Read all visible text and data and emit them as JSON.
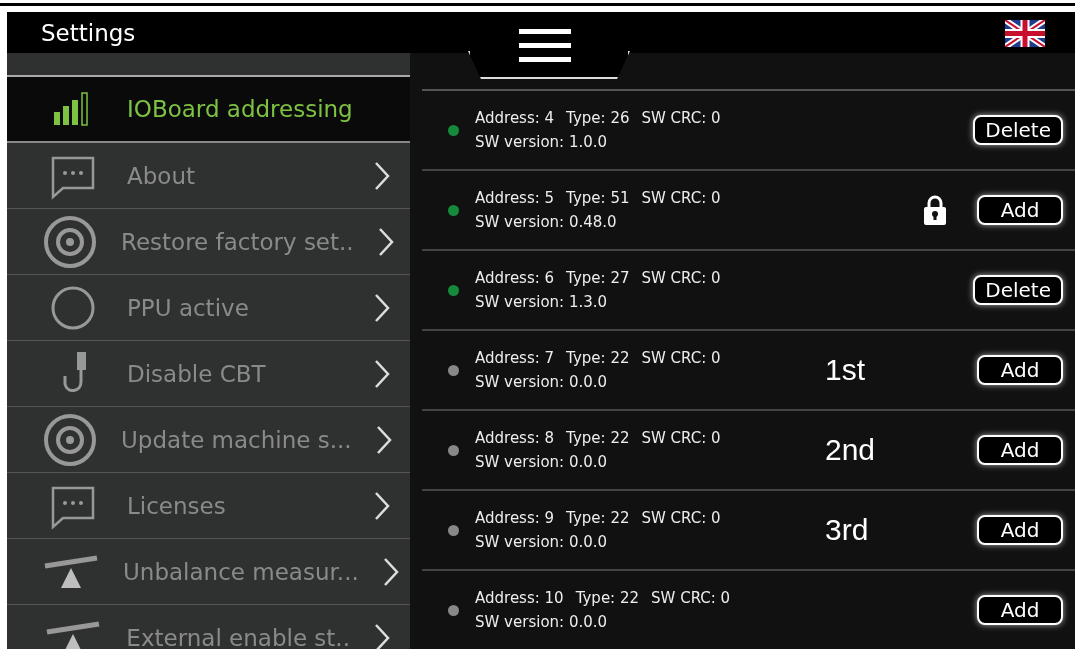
{
  "header": {
    "title": "Settings"
  },
  "sidebar": {
    "items": [
      {
        "label": "IOBoard addressing",
        "kind": "signal",
        "selected": true
      },
      {
        "label": "About",
        "kind": "bubble",
        "selected": false
      },
      {
        "label": "Restore factory set..",
        "kind": "target",
        "selected": false
      },
      {
        "label": "PPU active",
        "kind": "circle",
        "selected": false
      },
      {
        "label": "Disable CBT",
        "kind": "plug",
        "selected": false
      },
      {
        "label": "Update machine s...",
        "kind": "target",
        "selected": false
      },
      {
        "label": "Licenses",
        "kind": "bubble",
        "selected": false
      },
      {
        "label": "Unbalance measur...",
        "kind": "seesaw",
        "selected": false
      },
      {
        "label": "External enable st..",
        "kind": "seesaw",
        "selected": false
      }
    ]
  },
  "devices": [
    {
      "address": "Address: 4",
      "type": "Type: 26",
      "crc": "SW CRC: 0",
      "version": "SW version: 1.0.0",
      "active": true,
      "locked": false,
      "button": "Delete"
    },
    {
      "address": "Address: 5",
      "type": "Type: 51",
      "crc": "SW CRC: 0",
      "version": "SW version: 0.48.0",
      "active": true,
      "locked": true,
      "button": "Add"
    },
    {
      "address": "Address: 6",
      "type": "Type: 27",
      "crc": "SW CRC: 0",
      "version": "SW version: 1.3.0",
      "active": true,
      "locked": false,
      "button": "Delete"
    },
    {
      "address": "Address: 7",
      "type": "Type: 22",
      "crc": "SW CRC: 0",
      "version": "SW version: 0.0.0",
      "active": false,
      "locked": false,
      "note": "1st",
      "button": "Add"
    },
    {
      "address": "Address: 8",
      "type": "Type: 22",
      "crc": "SW CRC: 0",
      "version": "SW version: 0.0.0",
      "active": false,
      "locked": false,
      "note": "2nd",
      "button": "Add"
    },
    {
      "address": "Address: 9",
      "type": "Type: 22",
      "crc": "SW CRC: 0",
      "version": "SW version: 0.0.0",
      "active": false,
      "locked": false,
      "note": "3rd",
      "button": "Add"
    },
    {
      "address": "Address: 10",
      "type": "Type: 22",
      "crc": "SW CRC: 0",
      "version": "SW version: 0.0.0",
      "active": false,
      "locked": false,
      "button": "Add"
    }
  ]
}
